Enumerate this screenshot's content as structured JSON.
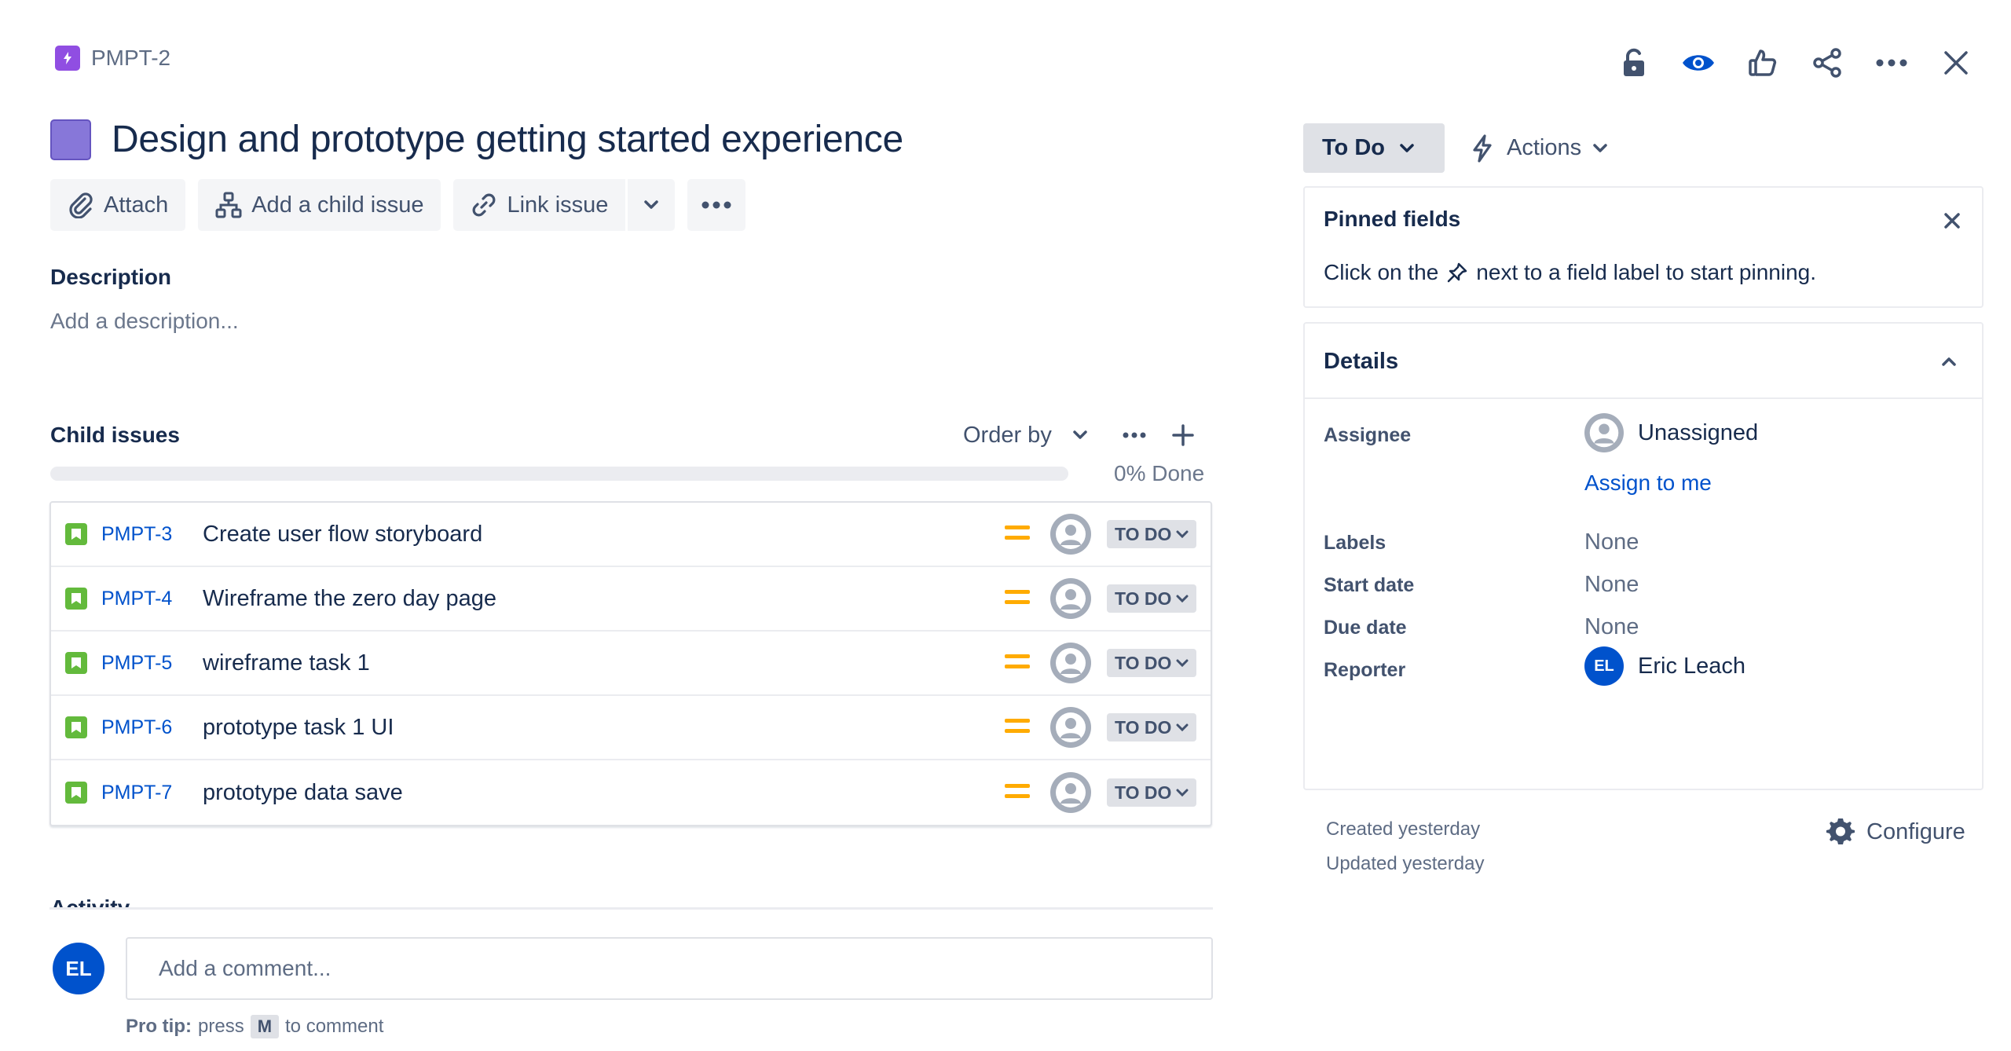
{
  "breadcrumb": {
    "key": "PMPT-2",
    "icon": "epic-lightning-icon",
    "epic_color": "#904ee2"
  },
  "header_actions": [
    {
      "name": "unlock-icon"
    },
    {
      "name": "watch-eye-icon"
    },
    {
      "name": "thumbs-up-icon"
    },
    {
      "name": "share-icon"
    },
    {
      "name": "more-horizontal-icon"
    },
    {
      "name": "close-icon"
    }
  ],
  "issue": {
    "title": "Design and prototype getting started experience",
    "swatch_color": "#8777d9"
  },
  "toolbar": {
    "attach": "Attach",
    "add_child": "Add a child issue",
    "link_issue": "Link issue"
  },
  "description": {
    "label": "Description",
    "placeholder": "Add a description..."
  },
  "child_issues": {
    "label": "Child issues",
    "order_by": "Order by",
    "progress_fraction": 0.0,
    "progress_text": "0% Done",
    "rows": [
      {
        "key": "PMPT-3",
        "summary": "Create user flow storyboard",
        "status": "TO DO"
      },
      {
        "key": "PMPT-4",
        "summary": "Wireframe the zero day page",
        "status": "TO DO"
      },
      {
        "key": "PMPT-5",
        "summary": "wireframe task 1",
        "status": "TO DO"
      },
      {
        "key": "PMPT-6",
        "summary": "prototype task 1 UI",
        "status": "TO DO"
      },
      {
        "key": "PMPT-7",
        "summary": "prototype data save",
        "status": "TO DO"
      }
    ]
  },
  "activity": {
    "label": "Activity"
  },
  "comment": {
    "avatar_initials": "EL",
    "placeholder": "Add a comment...",
    "protip_bold": "Pro tip:",
    "protip_press": "press",
    "protip_key": "M",
    "protip_rest": "to comment"
  },
  "status_button": {
    "label": "To Do"
  },
  "actions_button": {
    "label": "Actions"
  },
  "pinned": {
    "title": "Pinned fields",
    "msg_before": "Click on the",
    "msg_after": "next to a field label to start pinning."
  },
  "details": {
    "title": "Details",
    "assignee_label": "Assignee",
    "assignee_value": "Unassigned",
    "assign_to_me": "Assign to me",
    "labels_label": "Labels",
    "labels_value": "None",
    "start_label": "Start date",
    "start_value": "None",
    "due_label": "Due date",
    "due_value": "None",
    "reporter_label": "Reporter",
    "reporter_initials": "EL",
    "reporter_name": "Eric Leach"
  },
  "meta": {
    "created": "Created yesterday",
    "updated": "Updated yesterday",
    "configure": "Configure"
  },
  "colors": {
    "priority_medium": "#ffab00",
    "story_green": "#63ba3c",
    "link_blue": "#0052cc"
  }
}
